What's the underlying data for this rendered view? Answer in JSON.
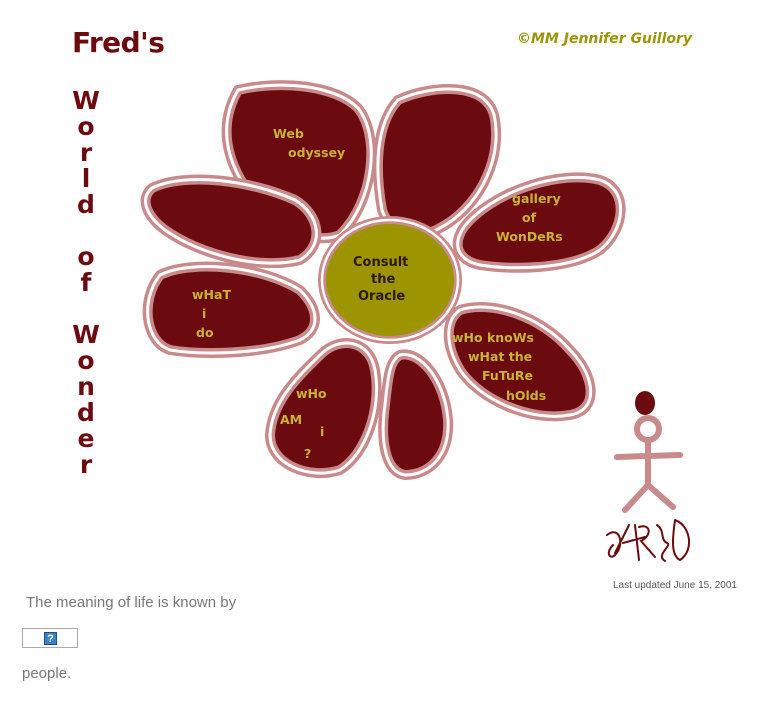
{
  "header": {
    "title": "Fred's",
    "copyright": "©MM Jennifer Guillory"
  },
  "vertical_title": {
    "letters_world": [
      "W",
      "o",
      "r",
      "l",
      "d"
    ],
    "letters_of": [
      "o",
      "f"
    ],
    "letters_wonder": [
      "W",
      "o",
      "n",
      "d",
      "e",
      "r"
    ]
  },
  "flower": {
    "center_label": [
      "Consult",
      "the",
      "Oracle"
    ],
    "petals": {
      "web": [
        "Web",
        "odyssey"
      ],
      "gallery": [
        "gallery",
        "of",
        "WonDeRs"
      ],
      "future": [
        "wHo knoWs",
        "wHat the",
        "FuTuRe",
        "hOlds"
      ],
      "who": [
        "wHo",
        "AM",
        "i",
        "?"
      ],
      "what": [
        "wHaT",
        "i",
        "do"
      ]
    }
  },
  "signature": "FRED",
  "footer": {
    "last_updated": "Last updated June 15, 2001",
    "meaning_text": "The meaning of life is known by",
    "counter_icon": "?",
    "people_text": "people."
  },
  "colors": {
    "maroon": "#6b0a0f",
    "olive": "#9c9400",
    "petal_text": "#c9b23a"
  }
}
